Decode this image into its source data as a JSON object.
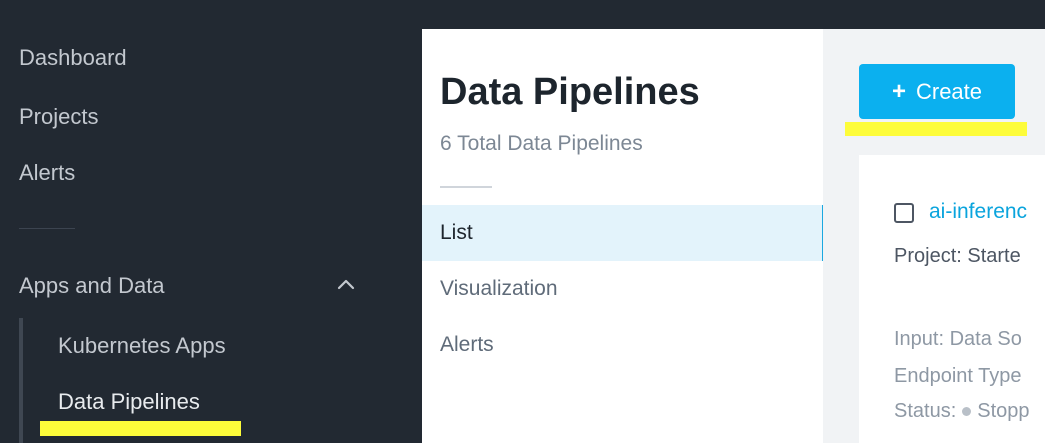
{
  "sidebar": {
    "items": [
      {
        "label": "Dashboard"
      },
      {
        "label": "Projects"
      },
      {
        "label": "Alerts"
      }
    ],
    "section": {
      "label": "Apps and Data",
      "expanded": true,
      "icon": "chevron-up-icon",
      "children": [
        {
          "label": "Kubernetes Apps"
        },
        {
          "label": "Data Pipelines",
          "active": true
        }
      ]
    }
  },
  "page": {
    "title": "Data Pipelines",
    "subtitle": "6 Total Data Pipelines"
  },
  "subnav": {
    "items": [
      {
        "label": "List",
        "active": true
      },
      {
        "label": "Visualization"
      },
      {
        "label": "Alerts"
      }
    ]
  },
  "toolbar": {
    "create_label": "Create",
    "create_icon": "+"
  },
  "pipeline_card": {
    "name": "ai-inferenc",
    "project": "Project: Starte",
    "input": "Input: Data So",
    "endpoint": "Endpoint Type",
    "status_label": "Status:",
    "status_value": "Stopp"
  },
  "colors": {
    "accent": "#0bb0ef",
    "sidebar_bg": "#222932",
    "highlight": "#fdfc3a",
    "active_row": "#e3f3fb"
  }
}
